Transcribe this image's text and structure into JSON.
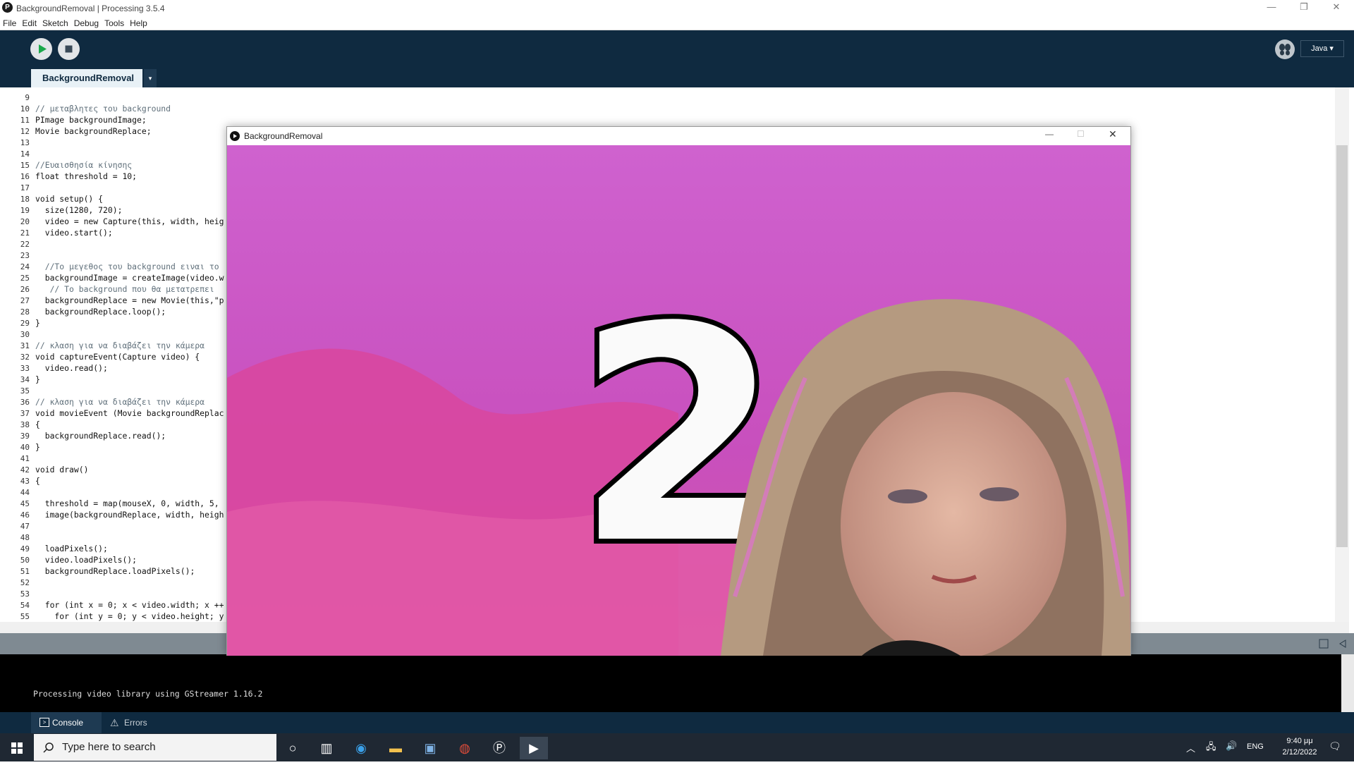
{
  "app": {
    "window_title": "BackgroundRemoval | Processing 3.5.4",
    "app_icon": "processing-logo-icon",
    "menus": [
      "File",
      "Edit",
      "Sketch",
      "Debug",
      "Tools",
      "Help"
    ]
  },
  "toolbar": {
    "run_icon": "play-icon",
    "stop_icon": "stop-icon",
    "debug_icon": "debugger-butterfly-icon",
    "mode_label": "Java ▾"
  },
  "tabs": {
    "active_label": "BackgroundRemoval",
    "menu_arrow": "▾"
  },
  "editor": {
    "lines": [
      {
        "n": "9",
        "t": ""
      },
      {
        "n": "10",
        "t": "// μεταβλητες του background"
      },
      {
        "n": "11",
        "t": "PImage backgroundImage;"
      },
      {
        "n": "12",
        "t": "Movie backgroundReplace;"
      },
      {
        "n": "13",
        "t": ""
      },
      {
        "n": "14",
        "t": ""
      },
      {
        "n": "15",
        "t": "//Ευαισθησία κίνησης"
      },
      {
        "n": "16",
        "t": "float threshold = 10;"
      },
      {
        "n": "17",
        "t": ""
      },
      {
        "n": "18",
        "t": "void setup() {"
      },
      {
        "n": "19",
        "t": "  size(1280, 720);"
      },
      {
        "n": "20",
        "t": "  video = new Capture(this, width, heig"
      },
      {
        "n": "21",
        "t": "  video.start();"
      },
      {
        "n": "22",
        "t": ""
      },
      {
        "n": "23",
        "t": ""
      },
      {
        "n": "24",
        "t": "  //Το μεγεθος του background ειναι το"
      },
      {
        "n": "25",
        "t": "  backgroundImage = createImage(video.w"
      },
      {
        "n": "26",
        "t": "   // Το background που θα μετατρεπει"
      },
      {
        "n": "27",
        "t": "  backgroundReplace = new Movie(this,\"p"
      },
      {
        "n": "28",
        "t": "  backgroundReplace.loop();"
      },
      {
        "n": "29",
        "t": "}"
      },
      {
        "n": "30",
        "t": ""
      },
      {
        "n": "31",
        "t": "// κλαση για να διαβάζει την κάμερα"
      },
      {
        "n": "32",
        "t": "void captureEvent(Capture video) {"
      },
      {
        "n": "33",
        "t": "  video.read();"
      },
      {
        "n": "34",
        "t": "}"
      },
      {
        "n": "35",
        "t": ""
      },
      {
        "n": "36",
        "t": "// κλαση για να διαβάζει την κάμερα"
      },
      {
        "n": "37",
        "t": "void movieEvent (Movie backgroundReplac"
      },
      {
        "n": "38",
        "t": "{"
      },
      {
        "n": "39",
        "t": "  backgroundReplace.read();"
      },
      {
        "n": "40",
        "t": "}"
      },
      {
        "n": "41",
        "t": ""
      },
      {
        "n": "42",
        "t": "void draw()"
      },
      {
        "n": "43",
        "t": "{"
      },
      {
        "n": "44",
        "t": ""
      },
      {
        "n": "45",
        "t": "  threshold = map(mouseX, 0, width, 5,"
      },
      {
        "n": "46",
        "t": "  image(backgroundReplace, width, heigh"
      },
      {
        "n": "47",
        "t": ""
      },
      {
        "n": "48",
        "t": ""
      },
      {
        "n": "49",
        "t": "  loadPixels();"
      },
      {
        "n": "50",
        "t": "  video.loadPixels();"
      },
      {
        "n": "51",
        "t": "  backgroundReplace.loadPixels();"
      },
      {
        "n": "52",
        "t": ""
      },
      {
        "n": "53",
        "t": ""
      },
      {
        "n": "54",
        "t": "  for (int x = 0; x < video.width; x ++"
      },
      {
        "n": "55",
        "t": "    for (int y = 0; y < video.height; y"
      }
    ]
  },
  "console": {
    "message": "Processing video library using GStreamer 1.16.2",
    "tab_console": "Console",
    "tab_errors": "Errors"
  },
  "sketch_window": {
    "title": "BackgroundRemoval",
    "overlay_text": "2"
  },
  "taskbar": {
    "search_placeholder": "Type here to search",
    "language": "ENG",
    "time": "9:40 μμ",
    "date": "2/12/2022"
  },
  "colors": {
    "ide_dark": "#0f2a40",
    "canvas_magenta": "#c95ac5",
    "tab_light": "#e8f1f6"
  }
}
